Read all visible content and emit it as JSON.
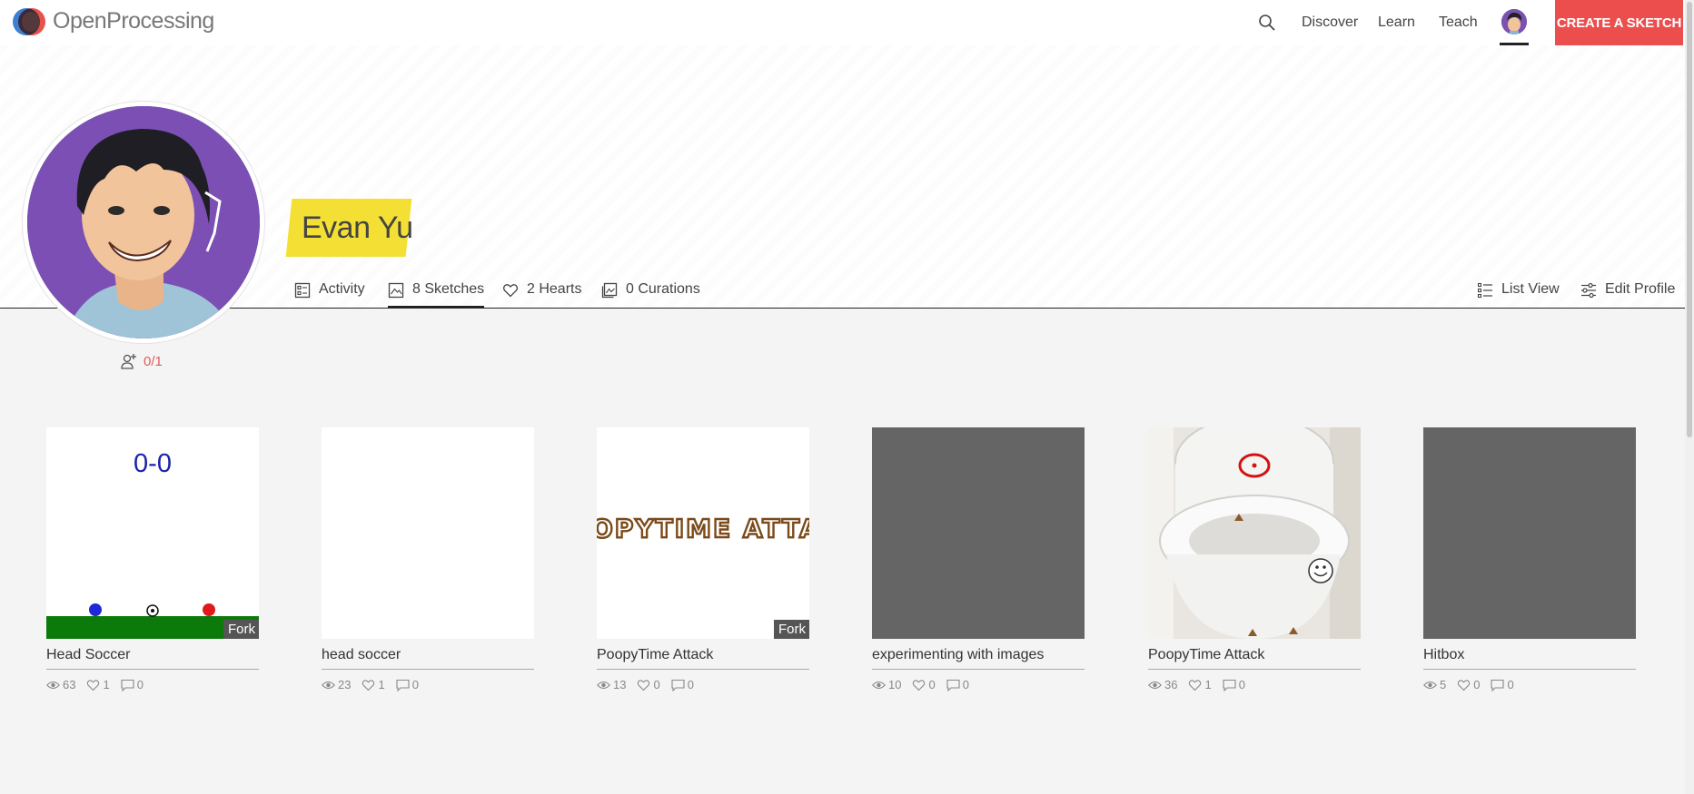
{
  "brand": {
    "name": "OpenProcessing"
  },
  "nav": {
    "links": [
      "Discover",
      "Learn",
      "Teach"
    ],
    "create_label": "CREATE A SKETCH"
  },
  "profile": {
    "name": "Evan Yu",
    "tabs": [
      {
        "label": "Activity",
        "icon": "activity-icon"
      },
      {
        "label": "8 Sketches",
        "icon": "sketches-icon",
        "active": true
      },
      {
        "label": "2 Hearts",
        "icon": "heart-icon"
      },
      {
        "label": "0 Curations",
        "icon": "curations-icon"
      }
    ],
    "actions": [
      {
        "label": "List View",
        "icon": "list-view-icon"
      },
      {
        "label": "Edit Profile",
        "icon": "settings-sliders-icon"
      }
    ],
    "follow": "0/1"
  },
  "sketches": [
    {
      "title": "Head Soccer",
      "views": "63",
      "hearts": "1",
      "comments": "0",
      "fork": "Fork",
      "score": "0-0"
    },
    {
      "title": "head soccer",
      "views": "23",
      "hearts": "1",
      "comments": "0"
    },
    {
      "title": "PoopyTime Attack",
      "views": "13",
      "hearts": "0",
      "comments": "0",
      "fork": "Fork",
      "banner": "OPYTIME ATTA"
    },
    {
      "title": "experimenting with images",
      "views": "10",
      "hearts": "0",
      "comments": "0"
    },
    {
      "title": "PoopyTime Attack",
      "views": "36",
      "hearts": "1",
      "comments": "0"
    },
    {
      "title": "Hitbox",
      "views": "5",
      "hearts": "0",
      "comments": "0"
    }
  ],
  "colors": {
    "accent": "#ec4e4e",
    "name_highlight": "#f4e034",
    "avatar_bg": "#7b4fb3"
  }
}
